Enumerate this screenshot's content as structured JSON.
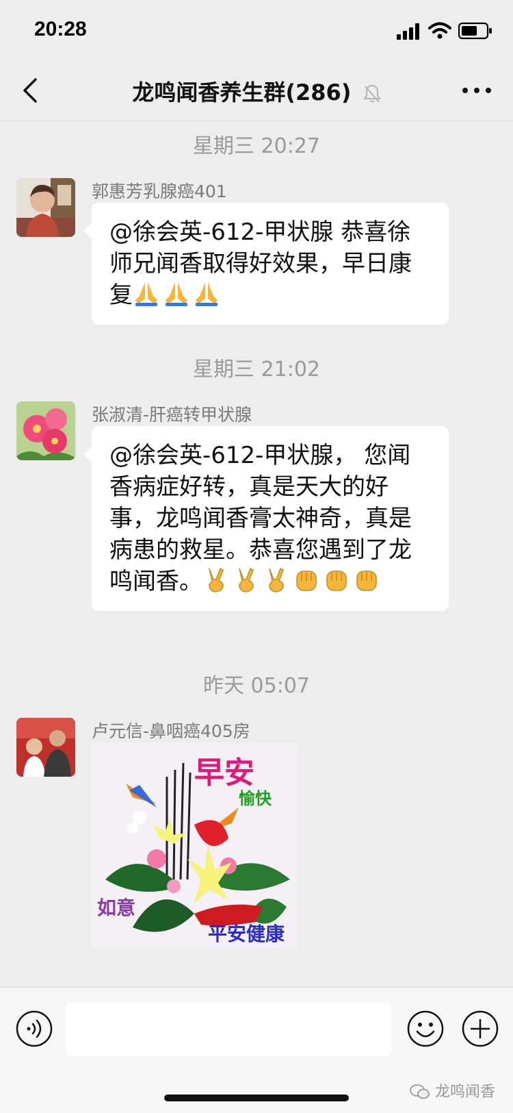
{
  "status": {
    "time": "20:28",
    "icons": [
      "cellular-signal-icon",
      "wifi-icon",
      "battery-icon"
    ]
  },
  "header": {
    "title": "龙鸣闻香养生群(286)",
    "muted_icon": "bell-muted-icon",
    "back_icon": "chevron-left-icon",
    "more_icon": "more-dots-icon"
  },
  "chat": {
    "timestamps": [
      "星期三 20:27",
      "星期三 21:02",
      "昨天 05:07"
    ],
    "messages": [
      {
        "sender": "郭惠芳乳腺癌401",
        "text": "@徐会英-612-甲状腺 恭喜徐师兄闻香取得好效果，早日康复",
        "emojis": [
          "folded-hands-emoji",
          "folded-hands-emoji",
          "folded-hands-emoji"
        ]
      },
      {
        "sender": "张淑清-肝癌转甲状腺",
        "text": "@徐会英-612-甲状腺， 您闻香病症好转，真是天大的好事，龙鸣闻香膏太神奇，真是病患的救星。恭喜您遇到了龙鸣闻香。",
        "emojis": [
          "victory-hand-emoji",
          "victory-hand-emoji",
          "victory-hand-emoji",
          "fist-emoji",
          "fist-emoji",
          "fist-emoji"
        ]
      },
      {
        "sender": "卢元信-鼻咽癌405房",
        "image_text": {
          "line1": "早安",
          "line2": "愉快",
          "line3": "如意",
          "line4": "平安健康"
        }
      }
    ]
  },
  "input_bar": {
    "text_value": "",
    "voice_icon": "voice-icon",
    "emoji_icon": "smiley-icon",
    "plus_icon": "plus-icon"
  },
  "watermark": "龙鸣闻香",
  "colors": {
    "background": "#ededed",
    "bubble": "#ffffff",
    "timestamp": "#9a9a9a",
    "sender": "#7a7a7a",
    "image_title": "#e0187a",
    "image_green": "#20a020",
    "image_purple": "#8a3aa8",
    "image_blue": "#2a2acf"
  }
}
